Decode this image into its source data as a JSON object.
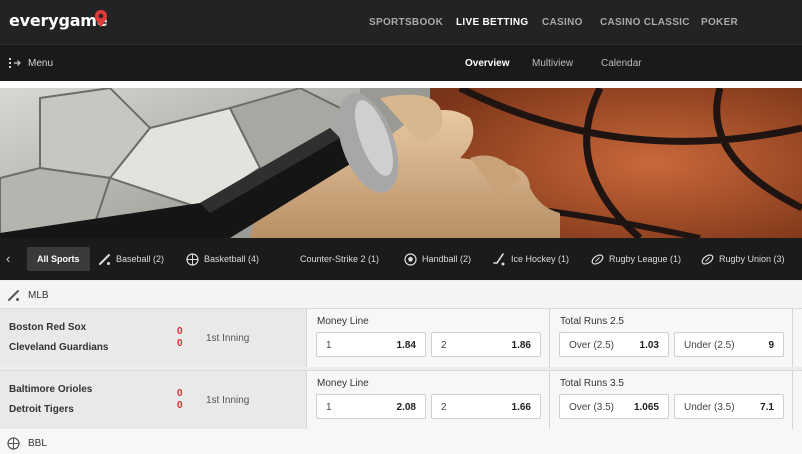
{
  "brand": {
    "name": "everygame"
  },
  "topnav": [
    "SPORTSBOOK",
    "LIVE BETTING",
    "CASINO",
    "CASINO CLASSIC",
    "POKER"
  ],
  "subbar": {
    "menu_label": "Menu",
    "tabs": [
      "Overview",
      "Multiview",
      "Calendar"
    ]
  },
  "sports_tabs": [
    "All Sports",
    "Baseball (2)",
    "Basketball (4)",
    "Counter-Strike 2 (1)",
    "Handball (2)",
    "Ice Hockey (1)",
    "Rugby League (1)",
    "Rugby Union (3)"
  ],
  "leagues": [
    {
      "name": "MLB",
      "icon": "baseball-bat-icon"
    },
    {
      "name": "BBL",
      "icon": "basketball-icon"
    }
  ],
  "events": [
    {
      "home": "Boston Red Sox",
      "away": "Cleveland Guardians",
      "home_score": "0",
      "away_score": "0",
      "status": "1st Inning",
      "moneyline": {
        "title": "Money Line",
        "o1_label": "1",
        "o1_value": "1.84",
        "o2_label": "2",
        "o2_value": "1.86"
      },
      "total": {
        "title": "Total Runs 2.5",
        "over_label": "Over (2.5)",
        "over_value": "1.03",
        "under_label": "Under (2.5)",
        "under_value": "9"
      }
    },
    {
      "home": "Baltimore Orioles",
      "away": "Detroit Tigers",
      "home_score": "0",
      "away_score": "0",
      "status": "1st Inning",
      "moneyline": {
        "title": "Money Line",
        "o1_label": "1",
        "o1_value": "2.08",
        "o2_label": "2",
        "o2_value": "1.66"
      },
      "total": {
        "title": "Total Runs 3.5",
        "over_label": "Over (3.5)",
        "over_value": "1.065",
        "under_label": "Under (3.5)",
        "under_value": "7.1"
      }
    }
  ],
  "colors": {
    "accent_red": "#e03a3a",
    "score_red": "#d32f2f",
    "topbar": "#232323"
  }
}
